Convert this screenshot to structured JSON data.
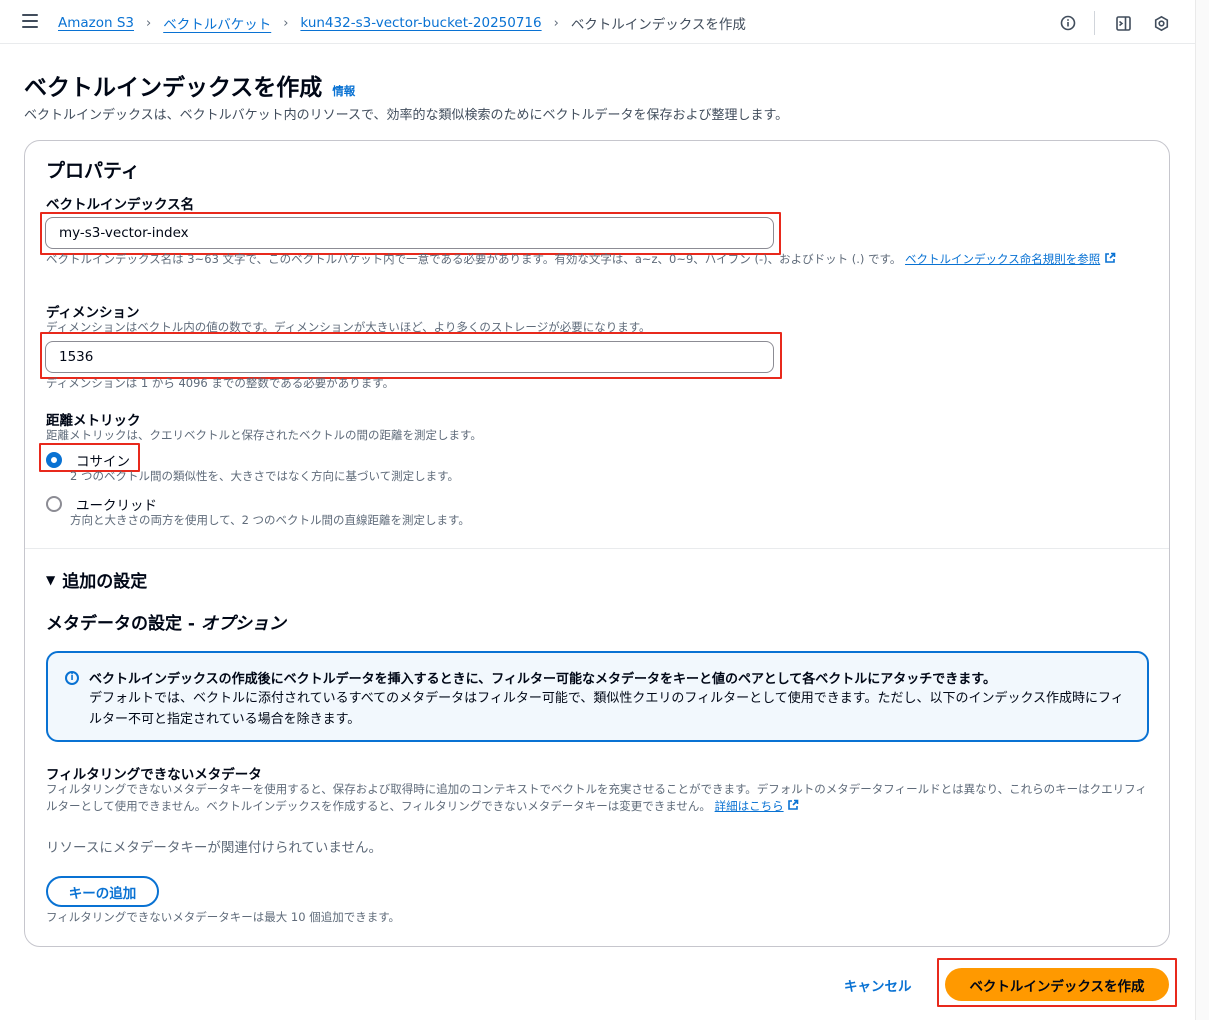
{
  "breadcrumb": {
    "items": [
      "Amazon S3",
      "ベクトルバケット",
      "kun432-s3-vector-bucket-20250716"
    ],
    "current": "ベクトルインデックスを作成"
  },
  "header": {
    "title": "ベクトルインデックスを作成",
    "info": "情報",
    "description": "ベクトルインデックスは、ベクトルバケット内のリソースで、効率的な類似検索のためにベクトルデータを保存および整理します。"
  },
  "properties": {
    "title": "プロパティ",
    "index_name": {
      "label": "ベクトルインデックス名",
      "value": "my-s3-vector-index",
      "hint": "ベクトルインデックス名は 3~63 文字で、このベクトルバケット内で一意である必要があります。有効な文字は、a~z、0~9、ハイフン (-)、およびドット (.) です。",
      "hint_link": "ベクトルインデックス命名規則を参照"
    },
    "dimension": {
      "label": "ディメンション",
      "description": "ディメンションはベクトル内の値の数です。ディメンションが大きいほど、より多くのストレージが必要になります。",
      "value": "1536",
      "hint": "ディメンションは 1 から 4096 までの整数である必要があります。"
    },
    "distance_metric": {
      "label": "距離メトリック",
      "description": "距離メトリックは、クエリベクトルと保存されたベクトルの間の距離を測定します。",
      "options": [
        {
          "label": "コサイン",
          "description": "2 つのベクトル間の類似性を、大きさではなく方向に基づいて測定します。",
          "selected": true
        },
        {
          "label": "ユークリッド",
          "description": "方向と大きさの両方を使用して、2 つのベクトル間の直線距離を測定します。",
          "selected": false
        }
      ]
    }
  },
  "additional": {
    "toggle_label": "追加の設定",
    "metadata_title": "メタデータの設定 - ",
    "metadata_title_optional": "オプション",
    "alert": {
      "title": "ベクトルインデックスの作成後にベクトルデータを挿入するときに、フィルター可能なメタデータをキーと値のペアとして各ベクトルにアタッチできます。",
      "body": "デフォルトでは、ベクトルに添付されているすべてのメタデータはフィルター可能で、類似性クエリのフィルターとして使用できます。ただし、以下のインデックス作成時にフィルター不可と指定されている場合を除きます。"
    },
    "non_filterable": {
      "label": "フィルタリングできないメタデータ",
      "description": "フィルタリングできないメタデータキーを使用すると、保存および取得時に追加のコンテキストでベクトルを充実させることができます。デフォルトのメタデータフィールドとは異なり、これらのキーはクエリフィルターとして使用できません。ベクトルインデックスを作成すると、フィルタリングできないメタデータキーは変更できません。",
      "link": "詳細はこちら",
      "empty": "リソースにメタデータキーが関連付けられていません。",
      "add_button": "キーの追加",
      "limit_hint": "フィルタリングできないメタデータキーは最大 10 個追加できます。"
    }
  },
  "footer": {
    "cancel": "キャンセル",
    "submit": "ベクトルインデックスを作成"
  },
  "colors": {
    "link": "#0972d3",
    "primary": "#ff9900",
    "highlight": "#e8291c"
  }
}
